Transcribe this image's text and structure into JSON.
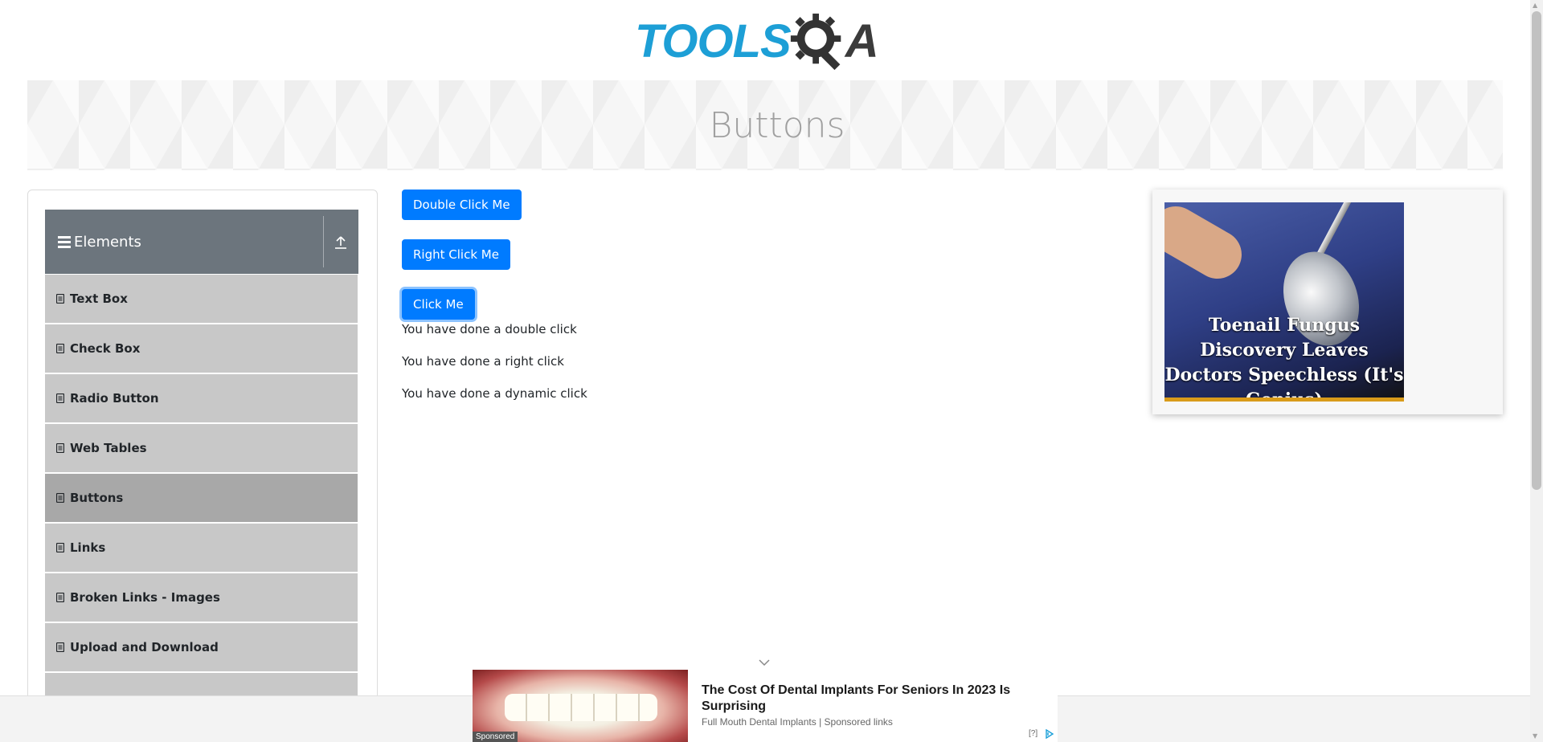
{
  "header": {
    "logo_text": "TOOLS",
    "logo_suffix": "A",
    "page_title": "Buttons"
  },
  "sidebar": {
    "group_title": "Elements",
    "items": [
      {
        "label": "Text Box"
      },
      {
        "label": "Check Box"
      },
      {
        "label": "Radio Button"
      },
      {
        "label": "Web Tables"
      },
      {
        "label": "Buttons",
        "active": true
      },
      {
        "label": "Links"
      },
      {
        "label": "Broken Links - Images"
      },
      {
        "label": "Upload and Download"
      }
    ]
  },
  "main": {
    "double_click_label": "Double Click Me",
    "right_click_label": "Right Click Me",
    "click_label": "Click Me",
    "double_click_message": "You have done a double click",
    "right_click_message": "You have done a right click",
    "dynamic_click_message": "You have done a dynamic click"
  },
  "side_ad": {
    "caption": "Toenail Fungus Discovery Leaves Doctors Speechless (It's Genius)"
  },
  "bottom_ad": {
    "sponsored": "Sponsored",
    "title": "The Cost Of Dental Implants For Seniors In 2023 Is Surprising",
    "source": "Full Mouth Dental Implants | Sponsored links",
    "info": "[?]"
  },
  "colors": {
    "primary_button": "#007bff",
    "sidebar_header": "#6c757d",
    "menu_item": "#c8c8c8",
    "menu_item_active": "#a8a8a8",
    "logo_blue": "#1d9fd6"
  }
}
